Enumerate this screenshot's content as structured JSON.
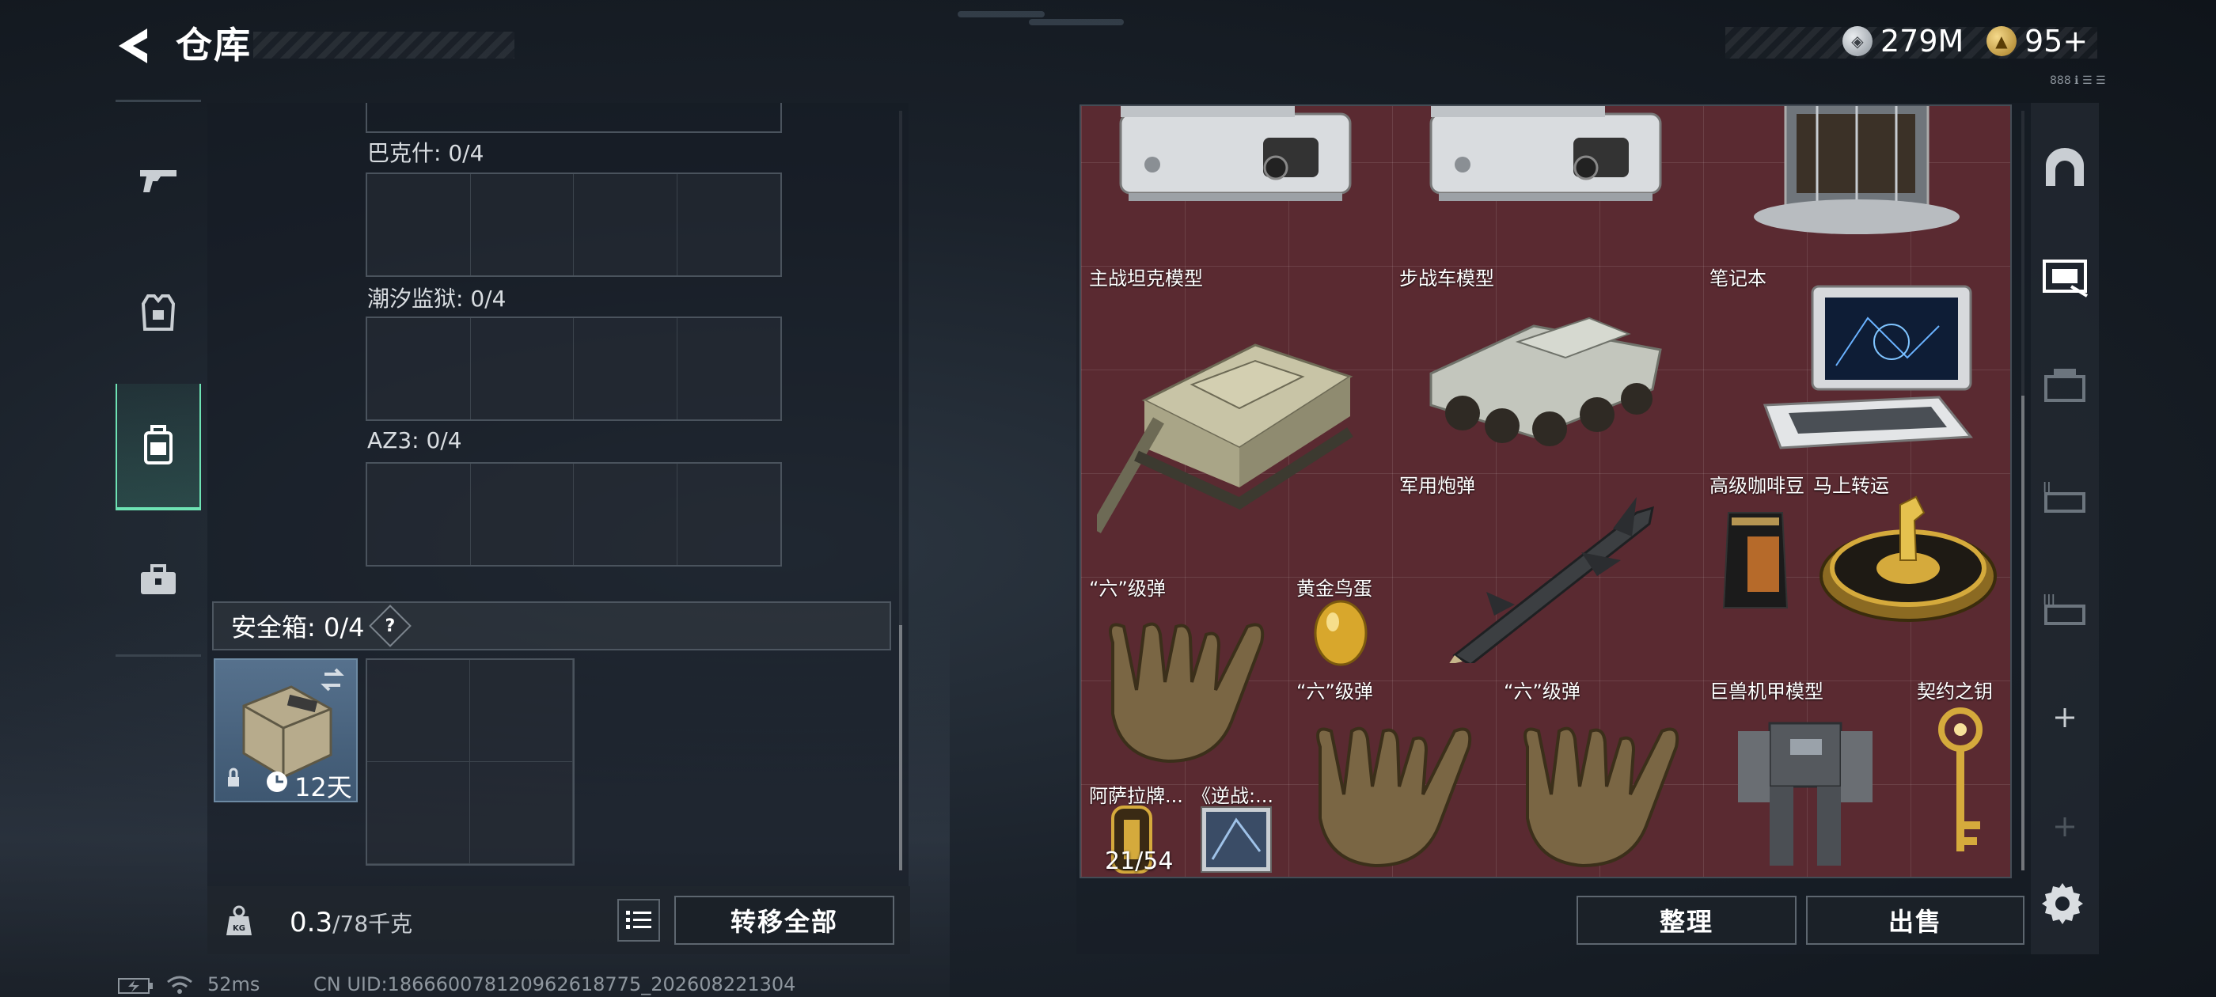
{
  "header": {
    "title": "仓库",
    "currencies": [
      {
        "icon": "silver-coin-icon",
        "value": "279M"
      },
      {
        "icon": "gold-coin-icon",
        "value": "95+"
      }
    ],
    "tiny_text": "888 ℹ ☰ ☰"
  },
  "left_sidebar": {
    "items": [
      {
        "name": "weapon",
        "icon": "gun-icon"
      },
      {
        "name": "armor",
        "icon": "vest-icon"
      },
      {
        "name": "backpack",
        "icon": "backpack-icon",
        "active": true
      },
      {
        "name": "case",
        "icon": "briefcase-icon"
      }
    ]
  },
  "loadout": {
    "slots": [
      {
        "label": "巴克什: 0/4"
      },
      {
        "label": "潮汐监狱: 0/4"
      },
      {
        "label": "AZ3: 0/4"
      }
    ],
    "safe_box": {
      "label": "安全箱: 0/4",
      "help": "?",
      "days": "12天"
    },
    "weight": {
      "current": "0.3",
      "max": "/78千克"
    },
    "transfer_all": "转移全部"
  },
  "stash": {
    "items": [
      {
        "name": "",
        "icon": "server-device-icon"
      },
      {
        "name": "",
        "icon": "server-device-icon"
      },
      {
        "name": "",
        "icon": "tower-model-icon"
      },
      {
        "name": "主战坦克模型",
        "icon": "tank-icon"
      },
      {
        "name": "步战车模型",
        "icon": "ifv-icon"
      },
      {
        "name": "笔记本",
        "icon": "laptop-icon"
      },
      {
        "name": "军用炮弹",
        "icon": "missile-icon"
      },
      {
        "name": "高级咖啡豆",
        "icon": "coffee-bag-icon"
      },
      {
        "name": "马上转运",
        "icon": "gold-horse-icon"
      },
      {
        "name": "“六”级弹",
        "icon": "hand-sign-icon"
      },
      {
        "name": "黄金鸟蛋",
        "icon": "golden-egg-icon"
      },
      {
        "name": "“六”级弹",
        "icon": "hand-sign-icon"
      },
      {
        "name": "“六”级弹",
        "icon": "hand-sign-icon"
      },
      {
        "name": "巨兽机甲模型",
        "icon": "mech-icon"
      },
      {
        "name": "契约之钥",
        "icon": "golden-key-icon"
      },
      {
        "name": "阿萨拉牌...",
        "icon": "card-icon",
        "count": "21/54"
      },
      {
        "name": "《逆战:...",
        "icon": "book-icon"
      }
    ],
    "sort_button": "整理",
    "sell_button": "出售"
  },
  "status_bar": {
    "ping": "52ms",
    "uid": "CN UID:18666007812096261877​5_202608221304"
  },
  "colors": {
    "accent": "#6ee3b4",
    "stash_bg": "#5a2a31",
    "panel_bg": "#1b222b"
  }
}
